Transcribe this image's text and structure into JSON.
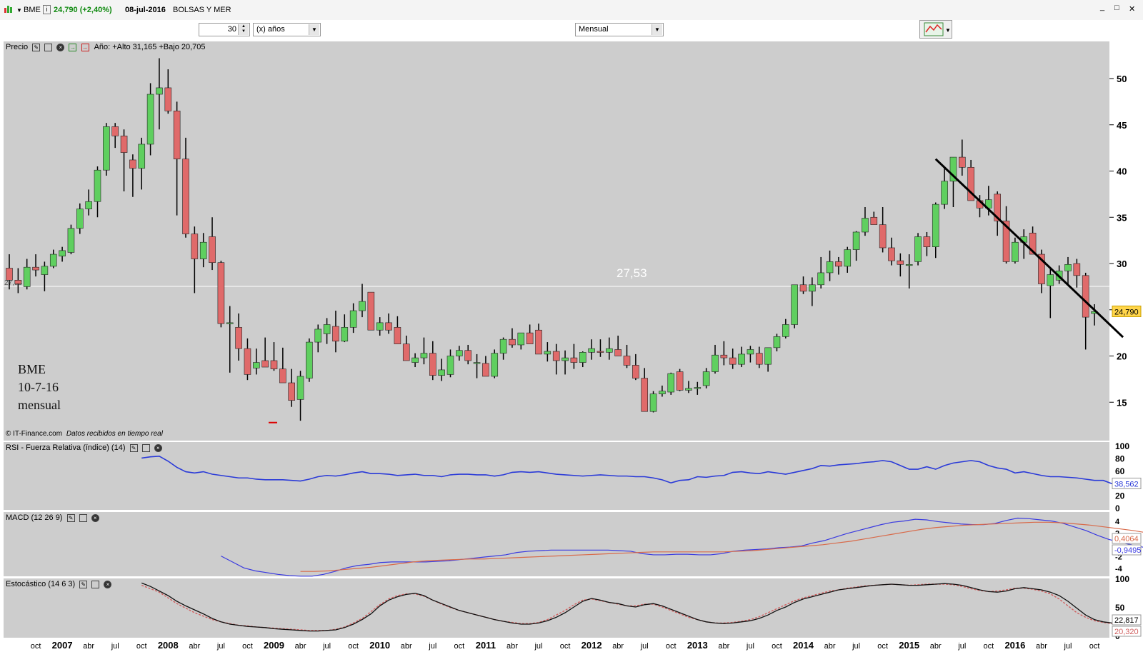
{
  "window": {
    "symbol": "BME",
    "price_change": "24,790 (+2,40%)",
    "date": "08-jul-2016",
    "market": "BOLSAS Y MER",
    "buttons": [
      "_",
      "□",
      "✕"
    ]
  },
  "toolbar": {
    "years_value": "30",
    "years_unit": "(x) años",
    "period": "Mensual"
  },
  "price_panel": {
    "label": "Precio",
    "stats": "Año: +Alto 31,165 +Bajo 20,705",
    "reference_line_label": "27,53",
    "last_price_tag": "24,790",
    "left_edge_label": "27,53",
    "footer_credit": "© IT-Finance.com",
    "footer_note": "Datos recibidos en tiempo real",
    "annotation": [
      "BME",
      "10-7-16",
      "mensual"
    ],
    "y_ticks": [
      "50",
      "45",
      "40",
      "35",
      "30",
      "25",
      "20",
      "15"
    ]
  },
  "rsi_panel": {
    "label": "RSI - Fuerza Relativa (índice) (14)",
    "y_ticks": [
      "100",
      "80",
      "60",
      "40",
      "20",
      "0"
    ],
    "value_tag": "38,562"
  },
  "macd_panel": {
    "label": "MACD (12 26 9)",
    "y_ticks": [
      "4",
      "2",
      "-2",
      "-4"
    ],
    "tags": [
      "0,4064",
      "-0,9495"
    ]
  },
  "stoch_panel": {
    "label": "Estocástico (14 6 3)",
    "y_ticks": [
      "100",
      "50",
      "0"
    ],
    "tags": [
      "22,817",
      "20,320"
    ]
  },
  "x_axis_labels": [
    "oct",
    "2007",
    "abr",
    "jul",
    "oct",
    "2008",
    "abr",
    "jul",
    "oct",
    "2009",
    "abr",
    "jul",
    "oct",
    "2010",
    "abr",
    "jul",
    "oct",
    "2011",
    "abr",
    "jul",
    "oct",
    "2012",
    "abr",
    "jul",
    "oct",
    "2013",
    "abr",
    "jul",
    "oct",
    "2014",
    "abr",
    "jul",
    "oct",
    "2015",
    "abr",
    "jul",
    "oct",
    "2016",
    "abr",
    "jul",
    "oct"
  ],
  "colors": {
    "up": "#5fcf5f",
    "down": "#e06a6a",
    "rsi": "#2a3ad8",
    "macd": "#3a3ae0",
    "signal": "#d86a4a",
    "stoch_k": "#111111",
    "stoch_d": "#d06060",
    "trend": "#000000"
  },
  "chart_data": {
    "type": "candlestick",
    "title": "BME",
    "period": "monthly",
    "x_start": "2006-07",
    "ylim": [
      12,
      52
    ],
    "candles": [
      [
        29.5,
        31.0,
        27.2,
        28.2
      ],
      [
        28.2,
        29.5,
        26.8,
        27.8
      ],
      [
        27.5,
        30.5,
        27.2,
        29.6
      ],
      [
        29.6,
        31.0,
        28.6,
        29.3
      ],
      [
        28.8,
        30.2,
        27.0,
        29.7
      ],
      [
        29.7,
        31.5,
        29.5,
        31.0
      ],
      [
        30.8,
        31.8,
        30.2,
        31.4
      ],
      [
        31.2,
        34.2,
        31.0,
        33.8
      ],
      [
        33.8,
        36.5,
        33.2,
        35.9
      ],
      [
        35.9,
        38.0,
        35.2,
        36.7
      ],
      [
        36.7,
        40.5,
        35.0,
        40.1
      ],
      [
        40.1,
        45.2,
        39.5,
        44.8
      ],
      [
        44.8,
        45.2,
        42.5,
        43.8
      ],
      [
        43.8,
        44.5,
        37.8,
        42.0
      ],
      [
        41.2,
        41.8,
        37.2,
        40.3
      ],
      [
        40.3,
        43.6,
        38.0,
        42.9
      ],
      [
        42.9,
        49.5,
        41.7,
        48.3
      ],
      [
        48.3,
        52.2,
        44.5,
        49.0
      ],
      [
        49.0,
        51.0,
        46.2,
        46.5
      ],
      [
        46.5,
        47.5,
        35.2,
        41.3
      ],
      [
        41.3,
        43.6,
        32.8,
        33.2
      ],
      [
        33.2,
        34.0,
        26.8,
        30.5
      ],
      [
        30.5,
        33.3,
        29.6,
        32.3
      ],
      [
        32.9,
        35.0,
        29.3,
        30.1
      ],
      [
        30.1,
        30.3,
        23.1,
        23.5
      ],
      [
        23.5,
        25.4,
        18.2,
        23.6
      ],
      [
        23.1,
        24.6,
        19.5,
        20.8
      ],
      [
        20.8,
        21.9,
        17.4,
        18.0
      ],
      [
        18.7,
        20.8,
        18.0,
        19.3
      ],
      [
        19.5,
        22.0,
        18.9,
        18.8
      ],
      [
        19.5,
        21.5,
        18.4,
        18.6
      ],
      [
        18.6,
        20.9,
        17.8,
        17.1
      ],
      [
        17.1,
        18.6,
        14.5,
        15.2
      ],
      [
        15.3,
        18.4,
        13.0,
        17.8
      ],
      [
        17.6,
        21.9,
        17.2,
        21.5
      ],
      [
        21.5,
        23.4,
        20.4,
        22.9
      ],
      [
        22.4,
        24.1,
        21.3,
        23.4
      ],
      [
        23.2,
        24.9,
        20.4,
        21.6
      ],
      [
        21.6,
        24.5,
        21.5,
        23.1
      ],
      [
        23.1,
        25.7,
        22.5,
        24.9
      ],
      [
        24.9,
        27.8,
        24.2,
        25.9
      ],
      [
        26.9,
        26.9,
        22.9,
        22.8
      ],
      [
        22.8,
        24.2,
        22.2,
        23.6
      ],
      [
        23.6,
        24.6,
        22.4,
        22.8
      ],
      [
        23.1,
        24.3,
        21.5,
        21.3
      ],
      [
        21.3,
        22.2,
        19.5,
        19.5
      ],
      [
        19.3,
        20.3,
        18.8,
        19.8
      ],
      [
        19.8,
        22.0,
        19.1,
        20.3
      ],
      [
        20.3,
        21.6,
        17.4,
        17.9
      ],
      [
        17.9,
        19.7,
        17.3,
        18.5
      ],
      [
        18.0,
        20.7,
        17.7,
        20.0
      ],
      [
        20.0,
        21.1,
        19.5,
        20.6
      ],
      [
        20.6,
        21.2,
        19.1,
        19.5
      ],
      [
        19.2,
        20.2,
        17.6,
        19.3
      ],
      [
        19.2,
        20.0,
        17.8,
        17.8
      ],
      [
        17.8,
        20.7,
        17.6,
        20.3
      ],
      [
        20.3,
        22.0,
        19.6,
        21.8
      ],
      [
        21.8,
        23.0,
        20.9,
        21.2
      ],
      [
        21.2,
        22.4,
        20.7,
        22.5
      ],
      [
        22.5,
        23.4,
        21.6,
        21.3
      ],
      [
        22.8,
        23.5,
        20.4,
        20.2
      ],
      [
        20.2,
        21.5,
        19.4,
        20.5
      ],
      [
        20.5,
        21.3,
        18.0,
        19.5
      ],
      [
        19.5,
        20.6,
        18.0,
        19.8
      ],
      [
        19.8,
        21.3,
        18.6,
        19.3
      ],
      [
        19.3,
        20.5,
        18.8,
        20.4
      ],
      [
        20.4,
        21.8,
        19.6,
        20.8
      ],
      [
        20.5,
        21.8,
        19.9,
        20.4
      ],
      [
        20.4,
        22.0,
        19.6,
        20.8
      ],
      [
        20.7,
        22.2,
        20.0,
        20.0
      ],
      [
        20.0,
        21.2,
        18.7,
        19.0
      ],
      [
        19.0,
        20.2,
        17.4,
        17.6
      ],
      [
        17.6,
        18.7,
        14.1,
        14.0
      ],
      [
        14.0,
        16.2,
        13.9,
        15.9
      ],
      [
        15.9,
        16.8,
        15.6,
        16.2
      ],
      [
        16.1,
        18.2,
        15.8,
        18.1
      ],
      [
        18.3,
        18.6,
        16.2,
        16.3
      ],
      [
        16.3,
        17.3,
        16.0,
        16.5
      ],
      [
        16.5,
        17.2,
        15.8,
        16.6
      ],
      [
        16.8,
        18.7,
        16.5,
        18.3
      ],
      [
        18.3,
        21.2,
        18.1,
        20.1
      ],
      [
        20.1,
        21.6,
        19.0,
        19.8
      ],
      [
        19.8,
        20.8,
        18.6,
        19.1
      ],
      [
        19.1,
        21.0,
        18.8,
        20.2
      ],
      [
        20.2,
        21.1,
        19.3,
        20.7
      ],
      [
        20.3,
        21.0,
        18.7,
        19.1
      ],
      [
        19.1,
        20.9,
        18.3,
        20.9
      ],
      [
        20.9,
        22.4,
        20.5,
        22.1
      ],
      [
        22.1,
        24.0,
        21.9,
        23.4
      ],
      [
        23.4,
        27.7,
        23.0,
        27.7
      ],
      [
        27.7,
        28.6,
        26.7,
        27.0
      ],
      [
        27.0,
        28.5,
        25.4,
        27.7
      ],
      [
        27.7,
        30.7,
        27.3,
        29.0
      ],
      [
        29.0,
        31.4,
        28.1,
        30.2
      ],
      [
        30.2,
        30.7,
        28.8,
        29.7
      ],
      [
        29.7,
        31.8,
        29.0,
        31.5
      ],
      [
        31.5,
        33.5,
        30.3,
        33.4
      ],
      [
        33.4,
        36.1,
        33.0,
        34.9
      ],
      [
        35.0,
        35.6,
        34.5,
        34.2
      ],
      [
        34.2,
        36.1,
        31.2,
        31.7
      ],
      [
        31.7,
        32.8,
        29.8,
        30.3
      ],
      [
        30.3,
        31.1,
        28.6,
        29.9
      ],
      [
        29.9,
        31.0,
        27.3,
        29.9
      ],
      [
        30.2,
        33.3,
        29.8,
        32.9
      ],
      [
        32.9,
        33.4,
        30.8,
        31.8
      ],
      [
        31.8,
        36.6,
        30.6,
        36.4
      ],
      [
        36.4,
        40.5,
        35.9,
        38.9
      ],
      [
        38.9,
        41.5,
        36.1,
        41.5
      ],
      [
        41.5,
        43.4,
        39.5,
        40.4
      ],
      [
        40.4,
        41.2,
        39.0,
        36.8
      ],
      [
        36.8,
        37.4,
        35.0,
        36.0
      ],
      [
        36.0,
        38.4,
        35.2,
        36.9
      ],
      [
        37.5,
        37.8,
        33.0,
        34.6
      ],
      [
        34.6,
        36.2,
        30.0,
        30.2
      ],
      [
        30.2,
        32.8,
        30.0,
        32.3
      ],
      [
        32.3,
        33.7,
        30.5,
        32.9
      ],
      [
        33.3,
        34.0,
        31.3,
        31.0
      ],
      [
        31.0,
        31.5,
        26.8,
        27.8
      ],
      [
        27.6,
        29.5,
        24.1,
        28.8
      ],
      [
        28.2,
        29.8,
        27.8,
        29.2
      ],
      [
        29.2,
        30.7,
        27.8,
        29.9
      ],
      [
        30.0,
        30.5,
        27.4,
        28.7
      ],
      [
        28.7,
        29.0,
        20.7,
        24.2
      ],
      [
        24.6,
        25.6,
        23.3,
        24.8
      ]
    ],
    "reference_level": 27.53,
    "trendline": {
      "start": {
        "date": "2015-04",
        "value": 41.3
      },
      "end": {
        "date": "2016-10",
        "value": 21.8
      }
    },
    "rsi": [
      80,
      82,
      83,
      75,
      65,
      58,
      56,
      58,
      54,
      52,
      50,
      48,
      48,
      46,
      45,
      45,
      45,
      44,
      43,
      46,
      50,
      52,
      51,
      53,
      56,
      58,
      55,
      55,
      54,
      52,
      53,
      54,
      52,
      52,
      50,
      53,
      54,
      54,
      53,
      53,
      51,
      53,
      57,
      58,
      57,
      58,
      56,
      54,
      53,
      52,
      51,
      52,
      53,
      52,
      51,
      51,
      50,
      50,
      48,
      45,
      40,
      44,
      45,
      50,
      49,
      51,
      52,
      57,
      58,
      56,
      55,
      58,
      56,
      54,
      57,
      60,
      63,
      68,
      67,
      69,
      70,
      71,
      73,
      74,
      76,
      74,
      68,
      62,
      62,
      66,
      62,
      68,
      72,
      74,
      76,
      74,
      68,
      64,
      62,
      56,
      58,
      55,
      52,
      50,
      50,
      49,
      48,
      46,
      44,
      44,
      38.6
    ],
    "rsi_start": "2007-10",
    "macd": [
      -2,
      -3,
      -4,
      -4.5,
      -4.8,
      -5.1,
      -5.3,
      -5.4,
      -5.4,
      -5.1,
      -4.6,
      -4,
      -3.6,
      -3.4,
      -3.1,
      -3,
      -3,
      -3,
      -3,
      -2.9,
      -2.8,
      -2.6,
      -2.4,
      -2.2,
      -2,
      -1.8,
      -1.4,
      -1.2,
      -1.1,
      -1.0,
      -1.0,
      -1.0,
      -1.0,
      -1.0,
      -1.0,
      -1.1,
      -1.2,
      -1.6,
      -1.8,
      -1.8,
      -1.7,
      -1.7,
      -1.8,
      -1.8,
      -1.6,
      -1.2,
      -1.0,
      -0.9,
      -0.8,
      -0.6,
      -0.5,
      -0.3,
      0.2,
      0.6,
      1.2,
      1.8,
      2.3,
      2.8,
      3.3,
      3.7,
      3.9,
      4.2,
      4.1,
      3.8,
      3.6,
      3.4,
      3.3,
      3.3,
      3.5,
      4.0,
      4.4,
      4.3,
      4.1,
      3.9,
      3.5,
      2.9,
      2.3,
      1.5,
      0.8,
      0.3,
      -0.1,
      -0.5,
      -0.8,
      -0.9
    ],
    "macd_signal": [
      -4.6,
      -4.6,
      -4.5,
      -4.3,
      -4.1,
      -3.9,
      -3.6,
      -3.3,
      -3.0,
      -2.8,
      -2.7,
      -2.6,
      -2.5,
      -2.5,
      -2.4,
      -2.3,
      -2.2,
      -2.1,
      -2.0,
      -1.9,
      -1.8,
      -1.7,
      -1.6,
      -1.5,
      -1.4,
      -1.3,
      -1.3,
      -1.3,
      -1.3,
      -1.3,
      -1.3,
      -1.2,
      -1.1,
      -0.9,
      -0.7,
      -0.5,
      -0.3,
      -0.1,
      0.2,
      0.5,
      0.9,
      1.3,
      1.7,
      2.1,
      2.5,
      2.8,
      3.0,
      3.2,
      3.3,
      3.4,
      3.5,
      3.6,
      3.7,
      3.7,
      3.6,
      3.4,
      3.2,
      2.9,
      2.6,
      2.3,
      1.9,
      1.5,
      1.2,
      0.9,
      0.6,
      0.4
    ],
    "macd_start": "2008-07",
    "macd_signal_start": "2009-04",
    "stoch_k": [
      92,
      86,
      78,
      70,
      60,
      52,
      45,
      38,
      30,
      24,
      20,
      18,
      16,
      15,
      14,
      12,
      11,
      10,
      9,
      8,
      8,
      9,
      10,
      14,
      20,
      28,
      38,
      52,
      62,
      68,
      72,
      74,
      70,
      62,
      56,
      50,
      44,
      40,
      36,
      32,
      28,
      25,
      22,
      20,
      20,
      22,
      26,
      32,
      40,
      50,
      60,
      65,
      62,
      58,
      56,
      52,
      50,
      54,
      56,
      52,
      46,
      40,
      34,
      28,
      24,
      22,
      21,
      22,
      24,
      26,
      30,
      36,
      44,
      50,
      58,
      64,
      68,
      72,
      76,
      80,
      82,
      84,
      86,
      88,
      89,
      90,
      89,
      88,
      88,
      89,
      90,
      91,
      90,
      88,
      84,
      80,
      77,
      76,
      78,
      82,
      84,
      82,
      80,
      76,
      70,
      60,
      48,
      36,
      28,
      24,
      22,
      20,
      20.3,
      22.8
    ],
    "stoch_d": [
      88,
      82,
      76,
      66,
      56,
      48,
      40,
      34,
      28,
      24,
      21,
      18,
      17,
      15,
      14,
      13,
      12,
      11,
      10,
      9,
      9,
      9,
      11,
      15,
      22,
      30,
      42,
      54,
      64,
      70,
      73,
      73,
      69,
      62,
      55,
      49,
      44,
      40,
      36,
      32,
      28,
      25,
      23,
      21,
      21,
      23,
      28,
      36,
      44,
      54,
      62,
      64,
      61,
      58,
      55,
      52,
      52,
      55,
      55,
      50,
      44,
      38,
      32,
      28,
      24,
      22,
      22,
      23,
      25,
      28,
      33,
      40,
      47,
      54,
      61,
      66,
      70,
      74,
      78,
      80,
      83,
      85,
      87,
      88,
      89,
      90,
      89,
      88,
      89,
      90,
      90,
      90,
      89,
      86,
      82,
      79,
      77,
      78,
      80,
      83,
      83,
      81,
      78,
      73,
      64,
      52,
      40,
      32,
      26,
      23,
      21,
      20,
      20.3,
      22.8
    ],
    "stoch_start": "2007-10"
  }
}
